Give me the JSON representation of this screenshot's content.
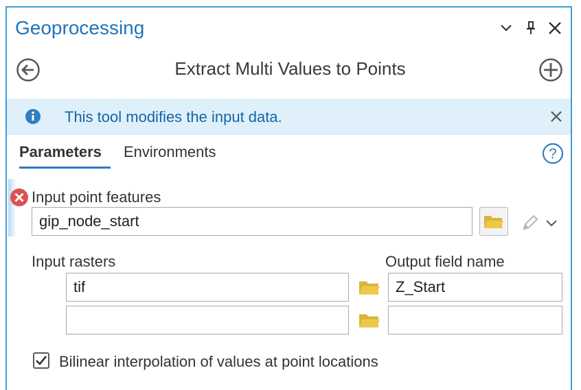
{
  "pane": {
    "title": "Geoprocessing",
    "tool_title": "Extract Multi Values to Points"
  },
  "banner": {
    "message": "This tool modifies the input data."
  },
  "tabs": [
    {
      "label": "Parameters",
      "active": true
    },
    {
      "label": "Environments",
      "active": false
    }
  ],
  "params": {
    "input_point_features": {
      "label": "Input point features",
      "value": "gip_node_start"
    },
    "input_rasters_label": "Input rasters",
    "output_field_label": "Output field name",
    "rows": [
      {
        "raster": "tif",
        "field": "Z_Start"
      },
      {
        "raster": "",
        "field": ""
      }
    ],
    "bilinear": {
      "label": "Bilinear interpolation of values at point locations",
      "checked": true
    }
  },
  "icons": {
    "dropdown": "chevron-down-icon",
    "pin": "pin-icon",
    "close": "close-icon",
    "back": "back-arrow-icon",
    "add": "add-circle-icon",
    "info": "info-icon",
    "help": "help-icon",
    "error": "error-icon",
    "folder": "folder-icon",
    "pencil": "pencil-icon"
  },
  "colors": {
    "accent": "#1f74b9",
    "banner_bg": "#dff0fa",
    "error": "#d9534f",
    "folder": "#d9b43a"
  }
}
